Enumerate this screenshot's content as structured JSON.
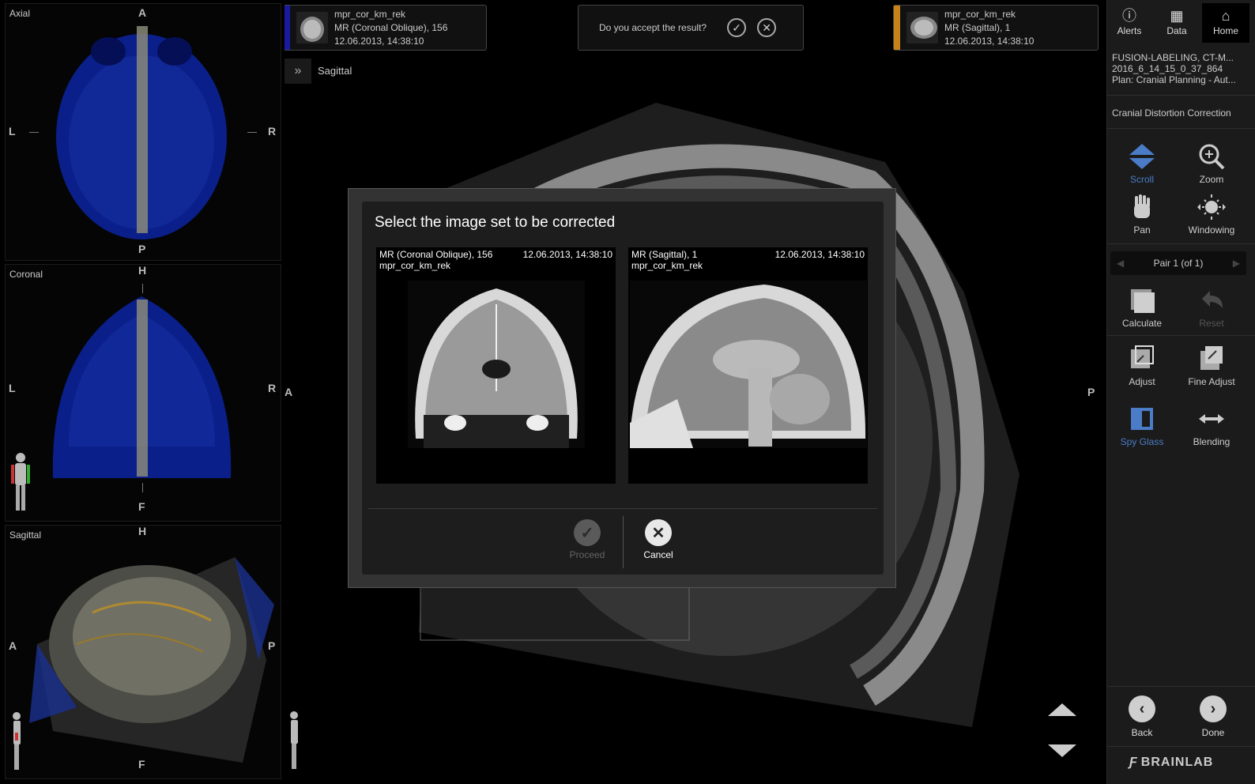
{
  "panels": {
    "axial": {
      "label": "Axial",
      "top": "A",
      "bottom": "P",
      "left": "L",
      "right": "R"
    },
    "coronal": {
      "label": "Coronal",
      "top": "H",
      "bottom": "F",
      "left": "L",
      "right": "R"
    },
    "sagittal": {
      "label": "Sagittal",
      "top": "H",
      "bottom": "F",
      "left": "A",
      "right": "P"
    }
  },
  "main": {
    "view_label": "Sagittal",
    "orient_left": "A",
    "orient_right": "P",
    "series_left": {
      "name": "mpr_cor_km_rek",
      "desc": "MR (Coronal Oblique), 156",
      "date": "12.06.2013, 14:38:10",
      "color": "#1a1aa0"
    },
    "series_right": {
      "name": "mpr_cor_km_rek",
      "desc": "MR (Sagittal), 1",
      "date": "12.06.2013, 14:38:10",
      "color": "#c8821a"
    },
    "accept_question": "Do you accept the result?"
  },
  "dialog": {
    "title": "Select the image set to be corrected",
    "cards": [
      {
        "desc": "MR (Coronal Oblique), 156",
        "name": "mpr_cor_km_rek",
        "date": "12.06.2013, 14:38:10"
      },
      {
        "desc": "MR (Sagittal), 1",
        "name": "mpr_cor_km_rek",
        "date": "12.06.2013, 14:38:10"
      }
    ],
    "proceed_label": "Proceed",
    "cancel_label": "Cancel"
  },
  "toolbar": {
    "top": {
      "alerts": "Alerts",
      "data": "Data",
      "home": "Home"
    },
    "info": [
      "FUSION-LABELING, CT-M...",
      "2016_6_14_15_0_37_864",
      "Plan: Cranial Planning - Aut..."
    ],
    "workflow_step": "Cranial Distortion Correction",
    "tools": {
      "scroll": "Scroll",
      "zoom": "Zoom",
      "pan": "Pan",
      "windowing": "Windowing",
      "calculate": "Calculate",
      "reset": "Reset",
      "adjust": "Adjust",
      "fine_adjust": "Fine Adjust",
      "spy_glass": "Spy Glass",
      "blending": "Blending"
    },
    "pair": "Pair 1 (of 1)",
    "back": "Back",
    "done": "Done",
    "logo": "BRAINLAB",
    "active_color": "#4a7cc7"
  }
}
